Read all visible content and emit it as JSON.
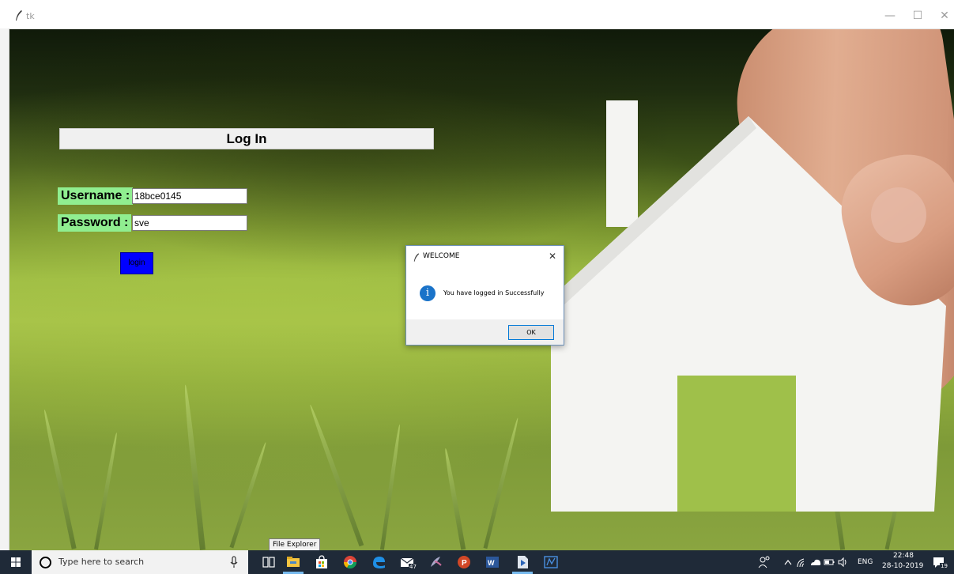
{
  "window": {
    "title": "tk",
    "minimize_glyph": "—",
    "maximize_glyph": "☐",
    "close_glyph": "✕"
  },
  "login": {
    "header": "Log In",
    "username_label": "Username :",
    "username_value": "18bce0145",
    "password_label": "Password :",
    "password_value": "sve",
    "login_button": "login"
  },
  "dialog": {
    "title": "WELCOME",
    "close_glyph": "✕",
    "info_glyph": "i",
    "message": "You have logged in Successfully",
    "ok_button": "OK"
  },
  "tooltip": {
    "text": "File Explorer"
  },
  "taskbar": {
    "search_placeholder": "Type here to search",
    "mail_badge": "47",
    "tray_lang": "ENG",
    "time": "22:48",
    "date": "28-10-2019",
    "notification_badge": "19",
    "icons": [
      "windows-start-icon",
      "cortana-search-icon",
      "microphone-icon",
      "task-view-icon",
      "file-explorer-icon",
      "microsoft-store-icon",
      "chrome-icon",
      "edge-icon",
      "mail-icon",
      "python-feather-icon",
      "powerpoint-icon",
      "word-icon",
      "pdf-reader-icon",
      "onenote-icon"
    ]
  },
  "colors": {
    "label_bg": "#90ee90",
    "login_button_bg": "#0000ff",
    "taskbar_bg": "#1f2a38",
    "info_icon": "#1a73c9"
  }
}
